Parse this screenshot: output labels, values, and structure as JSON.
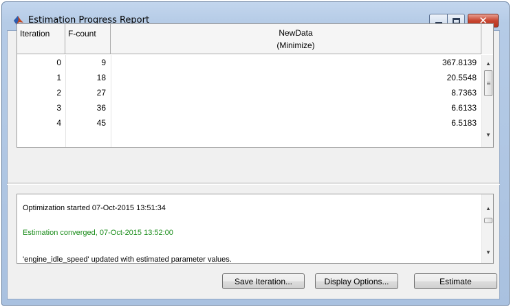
{
  "window": {
    "title": "Estimation Progress Report",
    "controls": {
      "minimize": "minimize-icon",
      "maximize": "maximize-icon",
      "close": "✕"
    }
  },
  "table": {
    "headers": {
      "iteration": "Iteration",
      "fcount": "F-count",
      "newdata": "NewData",
      "newdata_sub": "(Minimize)"
    },
    "rows": [
      {
        "iteration": "0",
        "fcount": "9",
        "value": "367.8139"
      },
      {
        "iteration": "1",
        "fcount": "18",
        "value": "20.5548"
      },
      {
        "iteration": "2",
        "fcount": "27",
        "value": "8.7363"
      },
      {
        "iteration": "3",
        "fcount": "36",
        "value": "6.6133"
      },
      {
        "iteration": "4",
        "fcount": "45",
        "value": "6.5183"
      }
    ]
  },
  "log": {
    "lines": [
      "Optimization started 07-Oct-2015 13:51:34",
      "Estimation converged, 07-Oct-2015 13:52:00",
      "'engine_idle_speed' updated with estimated parameter values."
    ],
    "converged_color": "#1a8c1a"
  },
  "buttons": {
    "save_iteration": "Save Iteration...",
    "display_options": "Display Options...",
    "estimate": "Estimate"
  },
  "colors": {
    "titlebar": "#b5cbe6",
    "close_button": "#c8452f",
    "panel_bg": "#f0f0f0"
  }
}
